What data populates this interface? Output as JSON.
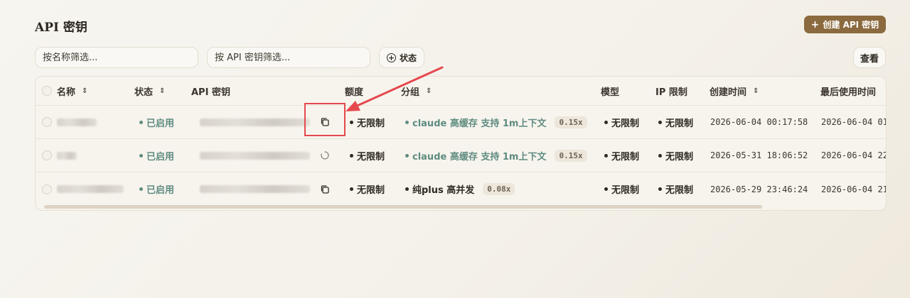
{
  "page": {
    "title": "API 密钥"
  },
  "toolbar": {
    "create_label": "创建 API 密钥",
    "name_filter_placeholder": "按名称筛选...",
    "key_filter_placeholder": "按 API 密钥筛选...",
    "status_label": "状态",
    "view_label": "查看"
  },
  "table": {
    "headers": {
      "name": "名称",
      "status": "状态",
      "key": "API 密钥",
      "quota": "额度",
      "group": "分组",
      "model": "模型",
      "ip": "IP 限制",
      "created": "创建时间",
      "last_used": "最后使用时间"
    },
    "rows": [
      {
        "status": "已启用",
        "quota": "无限制",
        "group": "claude 高缓存 支持 1m上下文",
        "multiplier": "0.15x",
        "model": "无限制",
        "ip": "无限制",
        "created": "2026-06-04 00:17:58",
        "last_used": "2026-06-04 01"
      },
      {
        "status": "已启用",
        "quota": "无限制",
        "group": "claude 高缓存 支持 1m上下文",
        "multiplier": "0.15x",
        "model": "无限制",
        "ip": "无限制",
        "created": "2026-05-31 18:06:52",
        "last_used": "2026-06-04 22"
      },
      {
        "status": "已启用",
        "quota": "无限制",
        "group": "纯plus 高并发",
        "multiplier": "0.08x",
        "model": "无限制",
        "ip": "无限制",
        "created": "2026-05-29 23:46:24",
        "last_used": "2026-06-04 21"
      }
    ]
  },
  "colors": {
    "accent": "#8a6a3e",
    "status_green": "#5f8c80",
    "annotation_red": "#e5484d"
  },
  "icons": [
    "plus-icon",
    "plus-circle-icon",
    "sort-icon",
    "copy-icon",
    "loading-icon"
  ]
}
